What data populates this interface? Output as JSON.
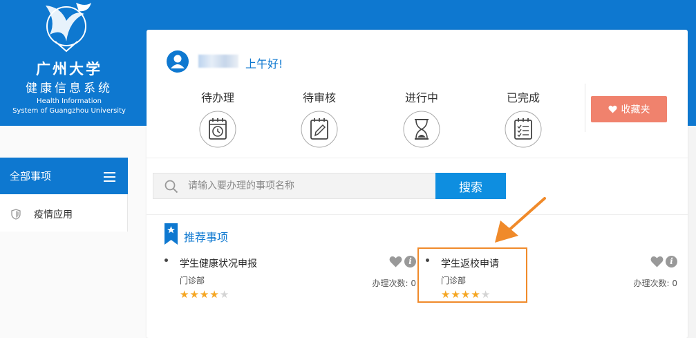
{
  "logo": {
    "cn_name": "广州大学",
    "cn_system": "健康信息系统",
    "en_line1": "Health Information",
    "en_line2": "System of Guangzhou University"
  },
  "sidebar": {
    "header_label": "全部事项",
    "items": [
      {
        "label": "疫情应用",
        "icon": "shield-icon"
      }
    ]
  },
  "user": {
    "greeting": "上午好!"
  },
  "stats": [
    {
      "label": "待办理",
      "icon": "clock-calendar-icon"
    },
    {
      "label": "待审核",
      "icon": "pencil-calendar-icon"
    },
    {
      "label": "进行中",
      "icon": "hourglass-icon"
    },
    {
      "label": "已完成",
      "icon": "checklist-icon"
    }
  ],
  "favorites_button": "收藏夹",
  "search": {
    "placeholder": "请输入要办理的事项名称",
    "button": "搜索"
  },
  "recommended": {
    "title": "推荐事项",
    "items": [
      {
        "name": "学生健康状况申报",
        "dept": "门诊部",
        "count_label": "办理次数: 0",
        "rating": 4,
        "max_rating": 5
      },
      {
        "name": "学生返校申请",
        "dept": "门诊部",
        "count_label": "办理次数: 0",
        "rating": 4,
        "max_rating": 5
      }
    ]
  },
  "colors": {
    "primary": "#0e78d0",
    "favorite": "#f0826d",
    "highlight": "#f08a2a",
    "star": "#f5a623"
  }
}
